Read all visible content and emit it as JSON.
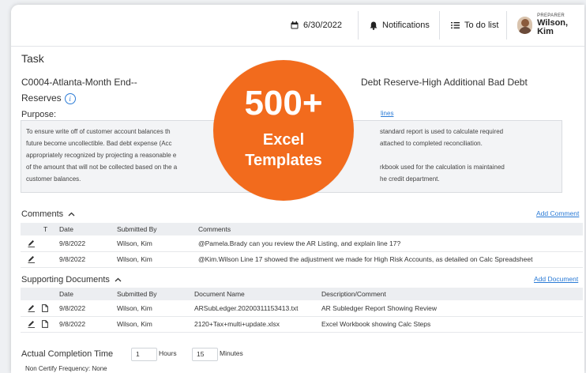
{
  "topbar": {
    "date": "6/30/2022",
    "notifications": "Notifications",
    "todo": "To do list",
    "preparer_label": "PREPARER",
    "preparer_name": "Wilson, Kim"
  },
  "task": {
    "section_title": "Task",
    "name_left": "C0004-Atlanta-Month End--",
    "name_right": "Debt Reserve-High Additional Bad Debt",
    "name_line2": "Reserves"
  },
  "purpose": {
    "label": "Purpose:",
    "link": "lines",
    "left_lines": [
      "To ensure write off of customer account balances th",
      "future become uncollectible. Bad debt expense (Acc",
      "appropriately recognized by projecting a reasonable e",
      "of the amount that will not be collected based on the a",
      "customer balances."
    ],
    "right_lines": [
      "standard report is used to calculate required",
      "attached to completed reconciliation.",
      "",
      "rkbook used for the calculation is maintained",
      "he credit department."
    ]
  },
  "comments": {
    "title": "Comments",
    "add_link": "Add Comment",
    "headers": [
      "T",
      "Date",
      "Submitted By",
      "Comments"
    ],
    "rows": [
      {
        "date": "9/8/2022",
        "by": "Wilson, Kim",
        "text": "@Pamela.Brady can you review the AR Listing, and explain line 17?"
      },
      {
        "date": "9/8/2022",
        "by": "Wilson, Kim",
        "text": "@Kim.Wilson Line 17 showed the adjustment we made for High Risk Accounts, as detailed on Calc Spreadsheet"
      }
    ]
  },
  "documents": {
    "title": "Supporting Documents",
    "add_link": "Add Document",
    "headers": [
      "Date",
      "Submitted By",
      "Document Name",
      "Description/Comment"
    ],
    "rows": [
      {
        "date": "9/8/2022",
        "by": "Wilson, Kim",
        "name": "ARSubLedger.20200311153413.txt",
        "desc": "AR Subledger Report Showing Review"
      },
      {
        "date": "9/8/2022",
        "by": "Wilson, Kim",
        "name": "2120+Tax+multi+update.xlsx",
        "desc": "Excel Workbook showing Calc Steps"
      }
    ]
  },
  "completion": {
    "label": "Actual Completion Time",
    "hours_value": "1",
    "hours_label": "Hours",
    "minutes_value": "15",
    "minutes_label": "Minutes",
    "frequency": "Non Certify Frequency: None"
  },
  "badge": {
    "number": "500+",
    "line1": "Excel",
    "line2": "Templates",
    "color": "#f26b1d"
  }
}
